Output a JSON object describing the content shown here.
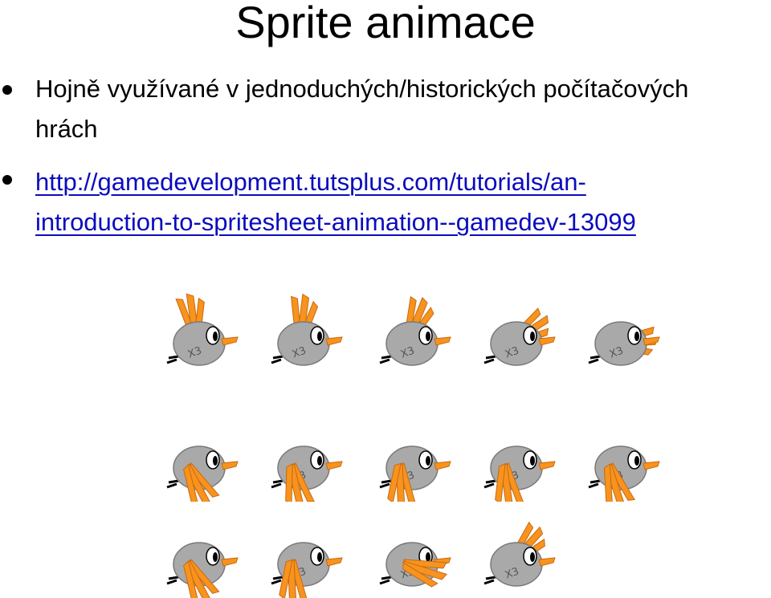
{
  "slide": {
    "title": "Sprite animace",
    "bullets": [
      {
        "text": "Hojně využívané v jednoduchých/historických počítačových hrách"
      },
      {
        "link": "http://gamedevelopment.tutsplus.com/tutorials/an-introduction-to-spritesheet-animation--gamedev-13099"
      }
    ]
  },
  "sprite_sheet": {
    "badge": "X3",
    "rows": 3,
    "frames_per_row": [
      5,
      5,
      4
    ],
    "colors": {
      "body": "#a9a9a9",
      "outline": "#7a7a7a",
      "wing": "#f7931e",
      "beak": "#f7931e",
      "eye_white": "#ffffff",
      "pupil": "#000000",
      "link": "#0b0bbf"
    },
    "icon_names": [
      "bird-sprite-frame"
    ]
  }
}
